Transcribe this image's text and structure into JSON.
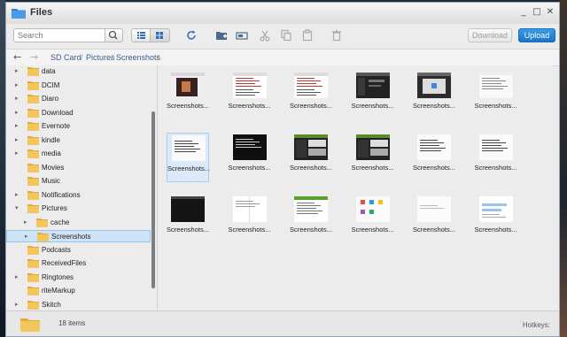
{
  "window": {
    "title": "Files",
    "minimize": "_",
    "maximize": "□",
    "close": "✕"
  },
  "toolbar": {
    "search_placeholder": "Search",
    "download_label": "Download",
    "upload_label": "Upload"
  },
  "breadcrumb": {
    "items": [
      "SD Card",
      "Pictures",
      "Screenshots"
    ],
    "sep": "/"
  },
  "sidebar": {
    "items": [
      {
        "label": "data",
        "expandable": true
      },
      {
        "label": "DCIM",
        "expandable": true
      },
      {
        "label": "Diaro",
        "expandable": true
      },
      {
        "label": "Download",
        "expandable": true
      },
      {
        "label": "Evernote",
        "expandable": true
      },
      {
        "label": "kindle",
        "expandable": true
      },
      {
        "label": "media",
        "expandable": true
      },
      {
        "label": "Movies",
        "expandable": false
      },
      {
        "label": "Music",
        "expandable": false
      },
      {
        "label": "Notifications",
        "expandable": true
      },
      {
        "label": "Pictures",
        "expandable": true,
        "expanded": true
      },
      {
        "label": "cache",
        "expandable": true,
        "child": true
      },
      {
        "label": "Screenshots",
        "expandable": true,
        "child": true,
        "selected": true
      },
      {
        "label": "Podcasts",
        "expandable": false
      },
      {
        "label": "ReceivedFiles",
        "expandable": false
      },
      {
        "label": "Ringtones",
        "expandable": true
      },
      {
        "label": "riteMarkup",
        "expandable": false
      },
      {
        "label": "Skitch",
        "expandable": true
      }
    ]
  },
  "files": [
    {
      "name": "Screenshots...",
      "thumb": "dark-photo"
    },
    {
      "name": "Screenshots...",
      "thumb": "white-red"
    },
    {
      "name": "Screenshots...",
      "thumb": "white-red"
    },
    {
      "name": "Screenshots...",
      "thumb": "dark-ui"
    },
    {
      "name": "Screenshots...",
      "thumb": "dark-dialog"
    },
    {
      "name": "Screenshots...",
      "thumb": "white-grid"
    },
    {
      "name": "Screenshots...",
      "thumb": "white-lines",
      "selected": true
    },
    {
      "name": "Screenshots...",
      "thumb": "black-text"
    },
    {
      "name": "Screenshots...",
      "thumb": "green-dark"
    },
    {
      "name": "Screenshots...",
      "thumb": "green-dark"
    },
    {
      "name": "Screenshots...",
      "thumb": "white-lines"
    },
    {
      "name": "Screenshots...",
      "thumb": "white-lines"
    },
    {
      "name": "Screenshots...",
      "thumb": "black"
    },
    {
      "name": "Screenshots...",
      "thumb": "white-doc"
    },
    {
      "name": "Screenshots...",
      "thumb": "white-green"
    },
    {
      "name": "Screenshots...",
      "thumb": "white-icons"
    },
    {
      "name": "Screenshots...",
      "thumb": "white-plain"
    },
    {
      "name": "Screenshots...",
      "thumb": "white-bars"
    }
  ],
  "status": {
    "items_count": "18 items",
    "hotkeys": "Hotkeys:"
  },
  "colors": {
    "accent": "#1a73c9",
    "folder": "#f2c65b",
    "selection": "#cfe3f7"
  }
}
